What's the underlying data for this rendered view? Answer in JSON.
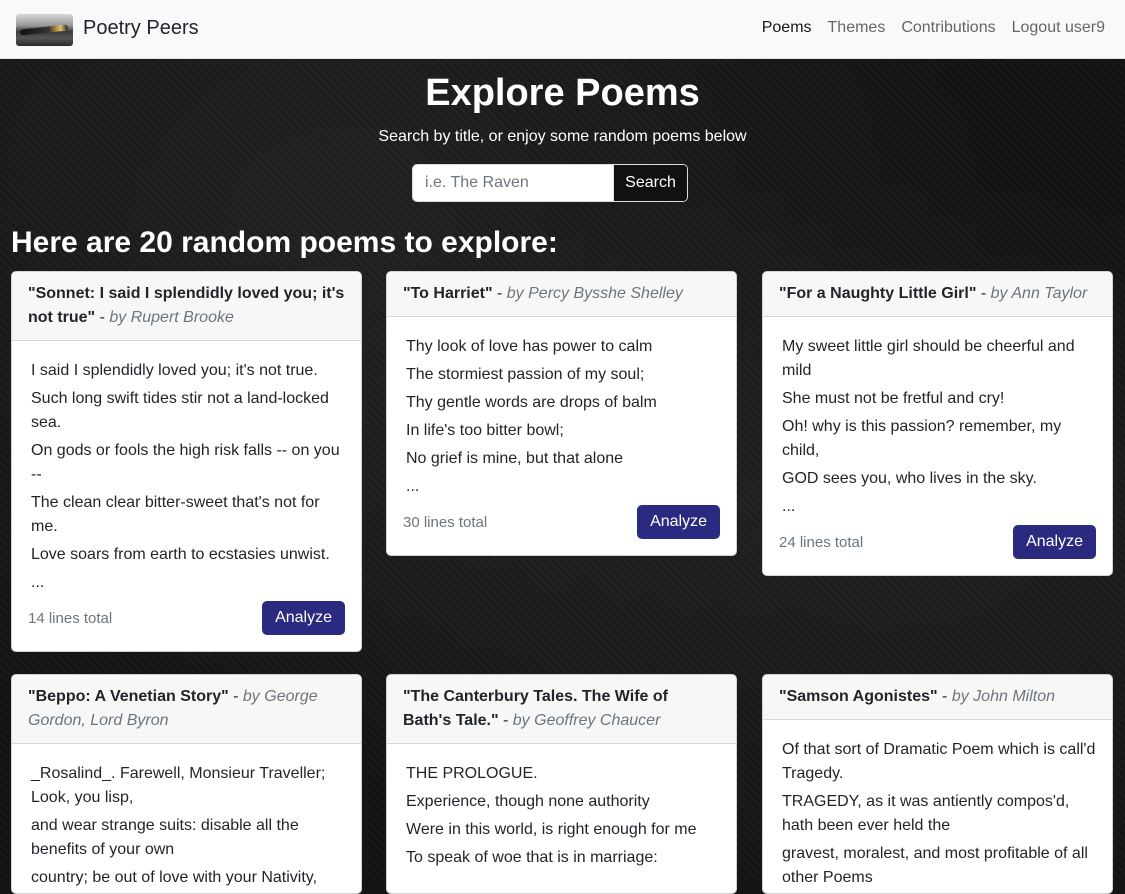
{
  "nav": {
    "brand": "Poetry Peers",
    "logo_icon": "fountain-pen-logo",
    "links": [
      "Poems",
      "Themes",
      "Contributions",
      "Logout user9"
    ]
  },
  "hero": {
    "title": "Explore Poems",
    "subtitle": "Search by title, or enjoy some random poems below",
    "search_placeholder": "i.e. The Raven",
    "search_button": "Search"
  },
  "section_heading": "Here are 20 random poems to explore:",
  "colors": {
    "accent": "#2a2a80",
    "navbar": "#f8f9fa",
    "background": "#151515"
  },
  "cards": [
    {
      "title": "\"Sonnet: I said I splendidly loved you; it's not true\"",
      "sep": " - ",
      "author": "by Rupert Brooke",
      "lines": [
        "I said I splendidly loved you; it's not true.",
        "Such long swift tides stir not a land-locked sea.",
        "On gods or fools the high risk falls -- on you --",
        "The clean clear bitter-sweet that's not for me.",
        "Love soars from earth to ecstasies unwist."
      ],
      "ellipsis": "...",
      "total": "14 lines total",
      "button": "Analyze"
    },
    {
      "title": "\"To Harriet\"",
      "sep": " - ",
      "author": "by Percy Bysshe Shelley",
      "lines": [
        "Thy look of love has power to calm",
        "The stormiest passion of my soul;",
        "Thy gentle words are drops of balm",
        "In life's too bitter bowl;",
        "No grief is mine, but that alone"
      ],
      "ellipsis": "...",
      "total": "30 lines total",
      "button": "Analyze"
    },
    {
      "title": "\"For a Naughty Little Girl\"",
      "sep": " - ",
      "author": "by Ann Taylor",
      "lines": [
        "My sweet little girl should be cheerful and mild",
        "She must not be fretful and cry!",
        "Oh! why is this passion? remember, my child,",
        "GOD sees you, who lives in the sky."
      ],
      "ellipsis": "...",
      "total": "24 lines total",
      "button": "Analyze"
    },
    {
      "title": "\"Beppo: A Venetian Story\"",
      "sep": " - ",
      "author": "by George Gordon, Lord Byron",
      "lines": [
        "_Rosalind_. Farewell, Monsieur Traveller; Look, you lisp,",
        "and wear strange suits: disable all the benefits of your own",
        "country; be out of love with your Nativity,"
      ]
    },
    {
      "title": "\"The Canterbury Tales. The Wife of Bath's Tale.\"",
      "sep": " - ",
      "author": "by Geoffrey Chaucer",
      "lines": [
        "THE PROLOGUE.",
        "Experience, though none authority",
        "Were in this world, is right enough for me",
        "To speak of woe that is in marriage:"
      ]
    },
    {
      "title": "\"Samson Agonistes\"",
      "sep": " - ",
      "author": "by John Milton",
      "lines": [
        "Of that sort of Dramatic Poem which is call'd Tragedy.",
        "TRAGEDY, as it was antiently compos'd, hath been ever held the",
        "gravest, moralest, and most profitable of all other Poems"
      ]
    }
  ]
}
